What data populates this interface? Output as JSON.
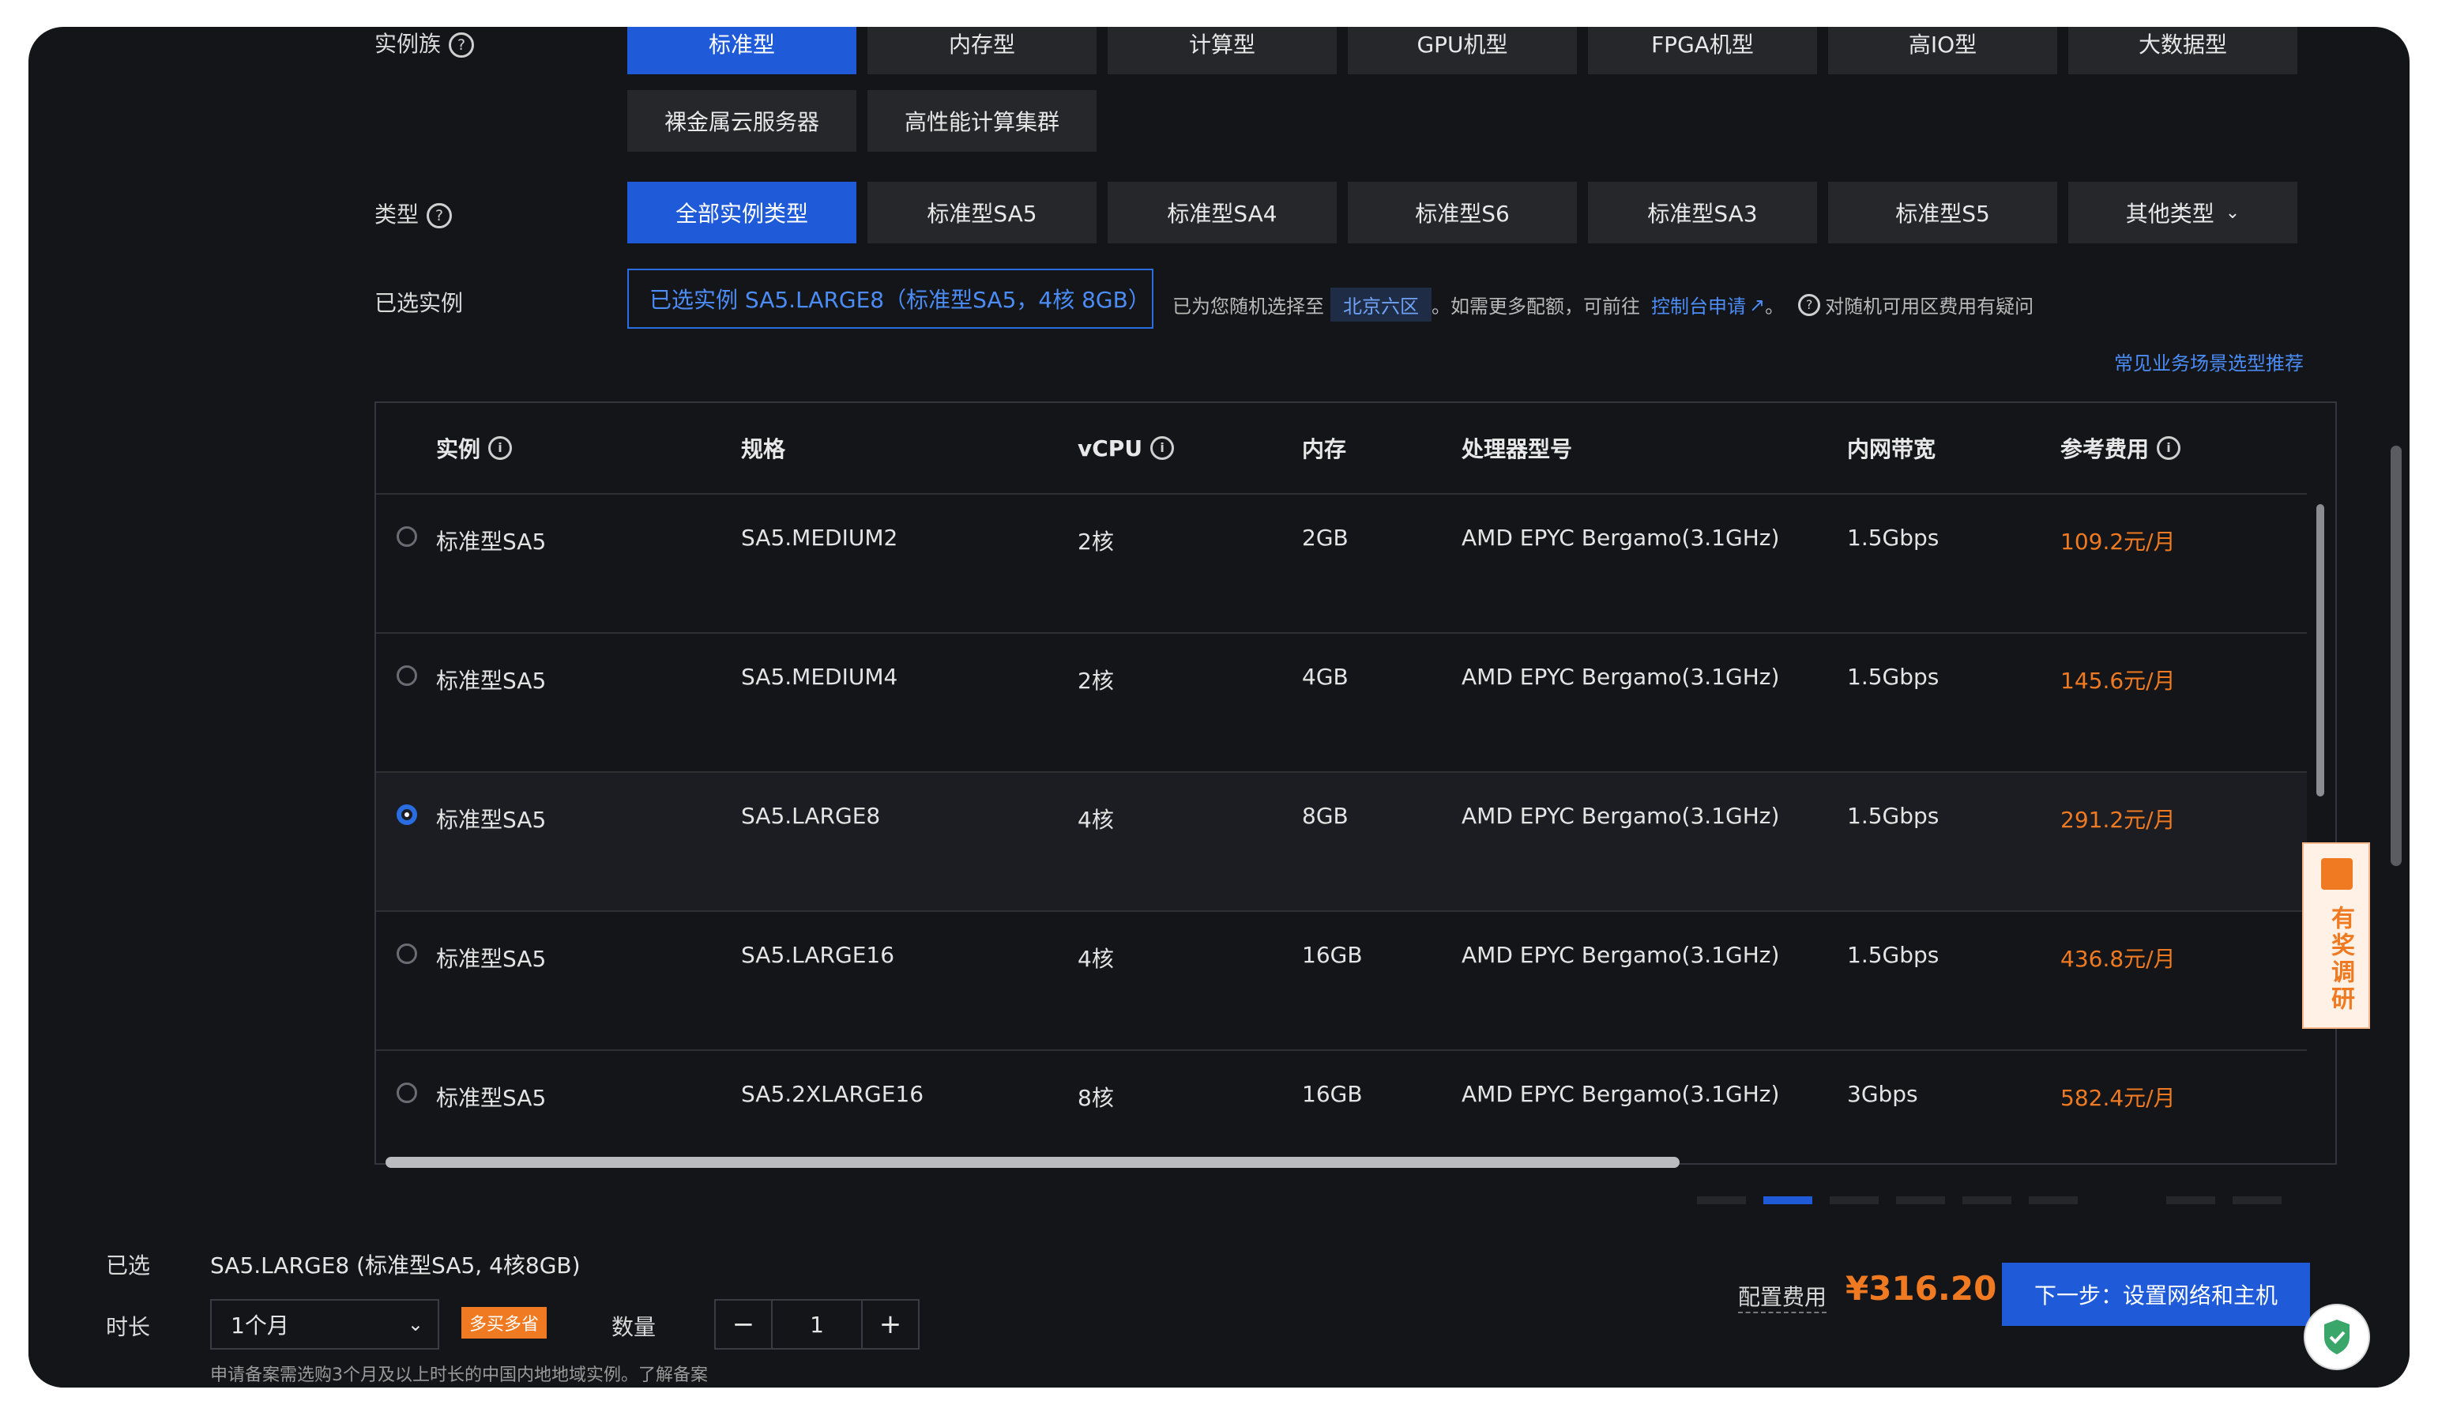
{
  "filters": {
    "instance_family": {
      "label": "实例族",
      "options": [
        "标准型",
        "内存型",
        "计算型",
        "GPU机型",
        "FPGA机型",
        "高IO型",
        "大数据型",
        "裸金属云服务器",
        "高性能计算集群"
      ],
      "selected": "标准型"
    },
    "type": {
      "label": "类型",
      "options": [
        "全部实例类型",
        "标准型SA5",
        "标准型SA4",
        "标准型S6",
        "标准型SA3",
        "标准型S5",
        "其他类型"
      ],
      "selected": "全部实例类型"
    },
    "selected_instance": {
      "label": "已选实例",
      "value": "已选实例 SA5.LARGE8（标准型SA5，4核 8GB）",
      "note_prefix": "已为您随机选择至",
      "region": "北京六区",
      "note_mid": "。如需更多配额，可前往",
      "console_link": "控制台申请",
      "note_end": "。",
      "question": "对随机可用区费用有疑问"
    },
    "recommend_link": "常见业务场景选型推荐"
  },
  "table": {
    "headers": {
      "instance": "实例",
      "spec": "规格",
      "vcpu": "vCPU",
      "memory": "内存",
      "processor": "处理器型号",
      "bandwidth": "内网带宽",
      "price": "参考费用"
    },
    "rows": [
      {
        "instance": "标准型SA5",
        "spec": "SA5.MEDIUM2",
        "vcpu": "2核",
        "memory": "2GB",
        "processor": "AMD EPYC Bergamo(3.1GHz)",
        "bandwidth": "1.5Gbps",
        "price": "109.2元/月",
        "selected": false
      },
      {
        "instance": "标准型SA5",
        "spec": "SA5.MEDIUM4",
        "vcpu": "2核",
        "memory": "4GB",
        "processor": "AMD EPYC Bergamo(3.1GHz)",
        "bandwidth": "1.5Gbps",
        "price": "145.6元/月",
        "selected": false
      },
      {
        "instance": "标准型SA5",
        "spec": "SA5.LARGE8",
        "vcpu": "4核",
        "memory": "8GB",
        "processor": "AMD EPYC Bergamo(3.1GHz)",
        "bandwidth": "1.5Gbps",
        "price": "291.2元/月",
        "selected": true
      },
      {
        "instance": "标准型SA5",
        "spec": "SA5.LARGE16",
        "vcpu": "4核",
        "memory": "16GB",
        "processor": "AMD EPYC Bergamo(3.1GHz)",
        "bandwidth": "1.5Gbps",
        "price": "436.8元/月",
        "selected": false
      },
      {
        "instance": "标准型SA5",
        "spec": "SA5.2XLARGE16",
        "vcpu": "8核",
        "memory": "16GB",
        "processor": "AMD EPYC Bergamo(3.1GHz)",
        "bandwidth": "3Gbps",
        "price": "582.4元/月",
        "selected": false
      }
    ]
  },
  "footer": {
    "selected_label": "已选",
    "selected_value": "SA5.LARGE8 (标准型SA5, 4核8GB)",
    "duration_label": "时长",
    "duration_value": "1个月",
    "promo_tag": "多买多省",
    "quantity_label": "数量",
    "quantity_value": "1",
    "minus": "−",
    "plus": "+",
    "note": "申请备案需选购3个月及以上时长的中国内地地域实例。了解备案",
    "fee_label": "配置费用",
    "fee_value": "¥316.20",
    "next_button": "下一步：设置网络和主机"
  },
  "survey": {
    "label": "有奖调研"
  },
  "icons": {
    "help": "question-circle-icon",
    "info": "info-circle-icon",
    "external": "external-link-icon",
    "chevron": "chevron-down-icon",
    "gift": "gift-icon",
    "shield": "shield-check-icon"
  },
  "colors": {
    "accent": "#1f5bd8",
    "price": "#f07a22",
    "link": "#4b8cf7",
    "background": "#141518"
  }
}
